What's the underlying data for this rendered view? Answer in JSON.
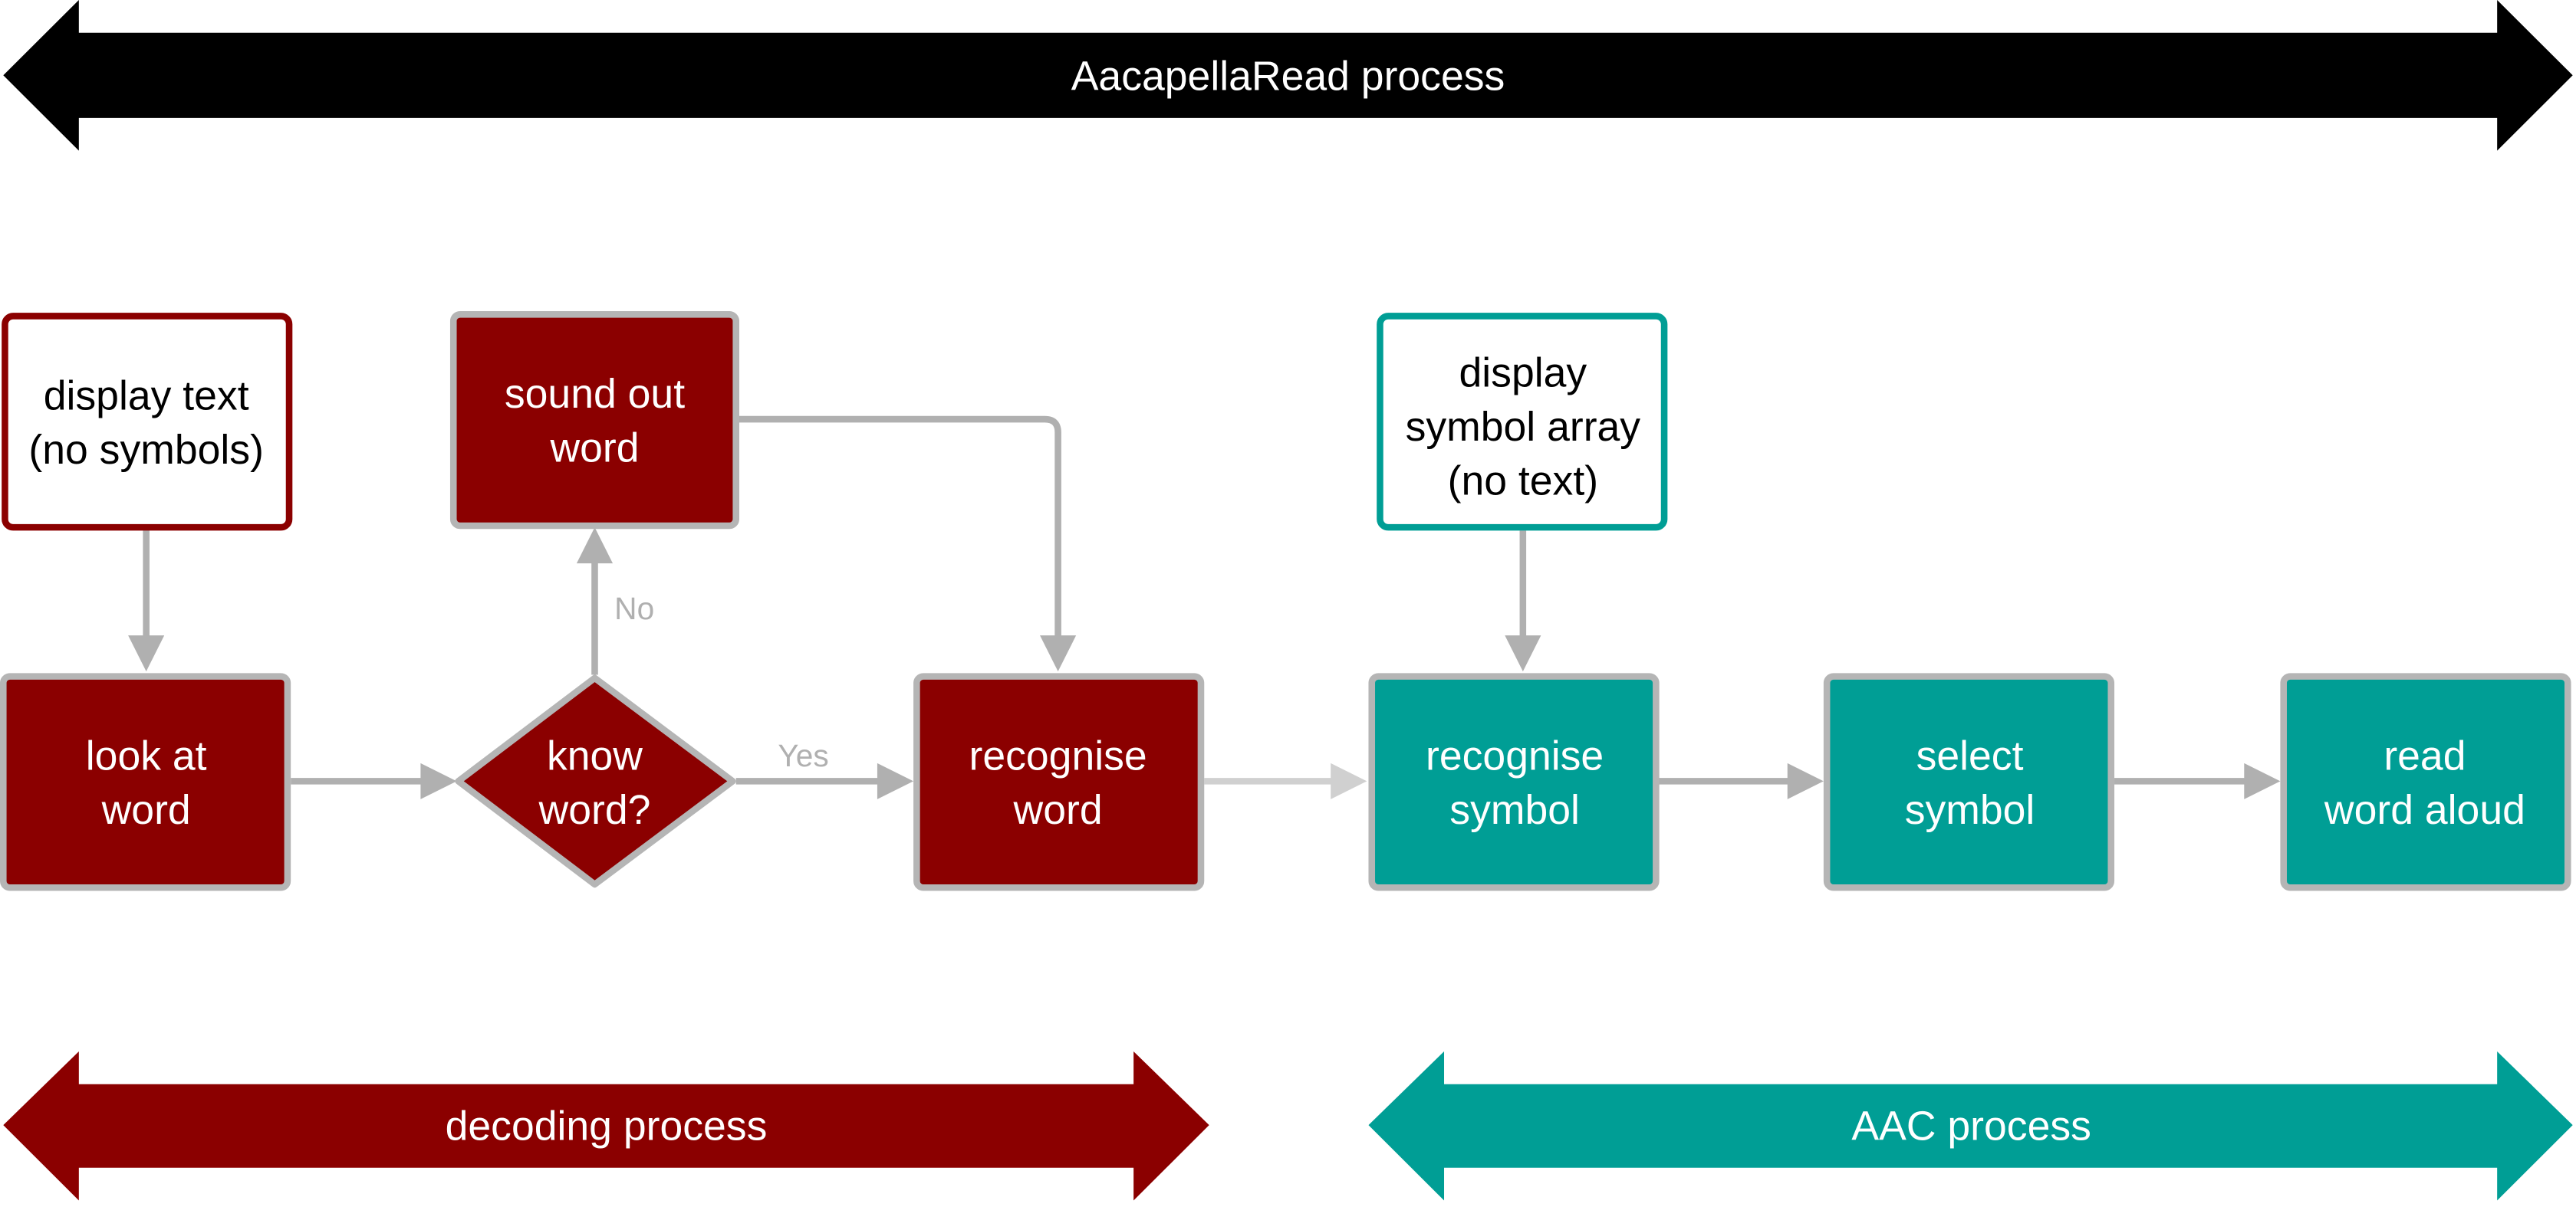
{
  "colors": {
    "decoding": "#8b0000",
    "aac": "#009e95",
    "overall": "#000000",
    "connector": "#b0b0b0",
    "connector_faint": "#d0d0d0",
    "node_border": "#b5b5b5"
  },
  "bands": {
    "overall": "AacapellaRead process",
    "decoding": "decoding process",
    "aac": "AAC process"
  },
  "nodes": {
    "display_text": [
      "display text",
      "(no symbols)"
    ],
    "look_at_word": [
      "look at",
      "word"
    ],
    "know_word": [
      "know",
      "word?"
    ],
    "sound_out_word": [
      "sound out",
      "word"
    ],
    "recognise_word": [
      "recognise",
      "word"
    ],
    "display_symbol_array": [
      "display",
      "symbol array",
      "(no text)"
    ],
    "recognise_symbol": [
      "recognise",
      "symbol"
    ],
    "select_symbol": [
      "select",
      "symbol"
    ],
    "read_word_aloud": [
      "read",
      "word aloud"
    ]
  },
  "edge_labels": {
    "no": "No",
    "yes": "Yes"
  }
}
